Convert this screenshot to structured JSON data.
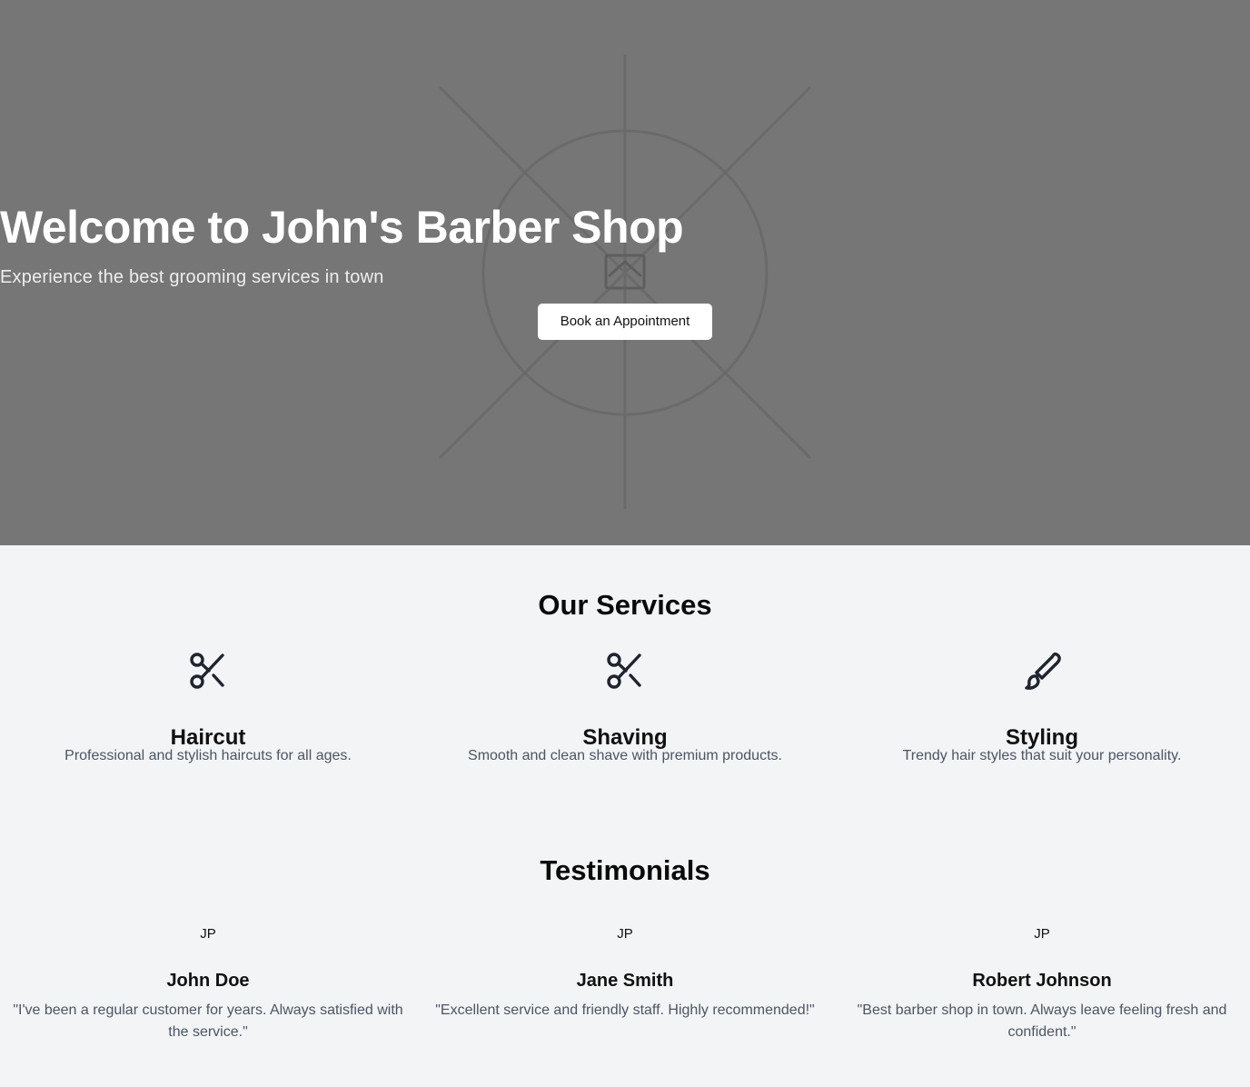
{
  "hero": {
    "title": "Welcome to John's Barber Shop",
    "subtitle": "Experience the best grooming services in town",
    "cta_label": "Book an Appointment",
    "background_color": "#767676",
    "placeholder_icon": "image-placeholder-icon"
  },
  "services": {
    "title": "Our Services",
    "items": [
      {
        "icon": "scissors-icon",
        "name": "Haircut",
        "description": "Professional and stylish haircuts for all ages."
      },
      {
        "icon": "scissors-icon",
        "name": "Shaving",
        "description": "Smooth and clean shave with premium products."
      },
      {
        "icon": "paintbrush-icon",
        "name": "Styling",
        "description": "Trendy hair styles that suit your personality."
      }
    ]
  },
  "testimonials": {
    "title": "Testimonials",
    "items": [
      {
        "avatar": "JP",
        "name": "John Doe",
        "quote": "\"I've been a regular customer for years. Always satisfied with the service.\""
      },
      {
        "avatar": "JP",
        "name": "Jane Smith",
        "quote": "\"Excellent service and friendly staff. Highly recommended!\""
      },
      {
        "avatar": "JP",
        "name": "Robert Johnson",
        "quote": "\"Best barber shop in town. Always leave feeling fresh and confident.\""
      }
    ]
  },
  "colors": {
    "page_background": "#f3f4f6",
    "heading": "#0a0a0a",
    "body_text": "#4b5563",
    "icon": "#1f2430"
  }
}
